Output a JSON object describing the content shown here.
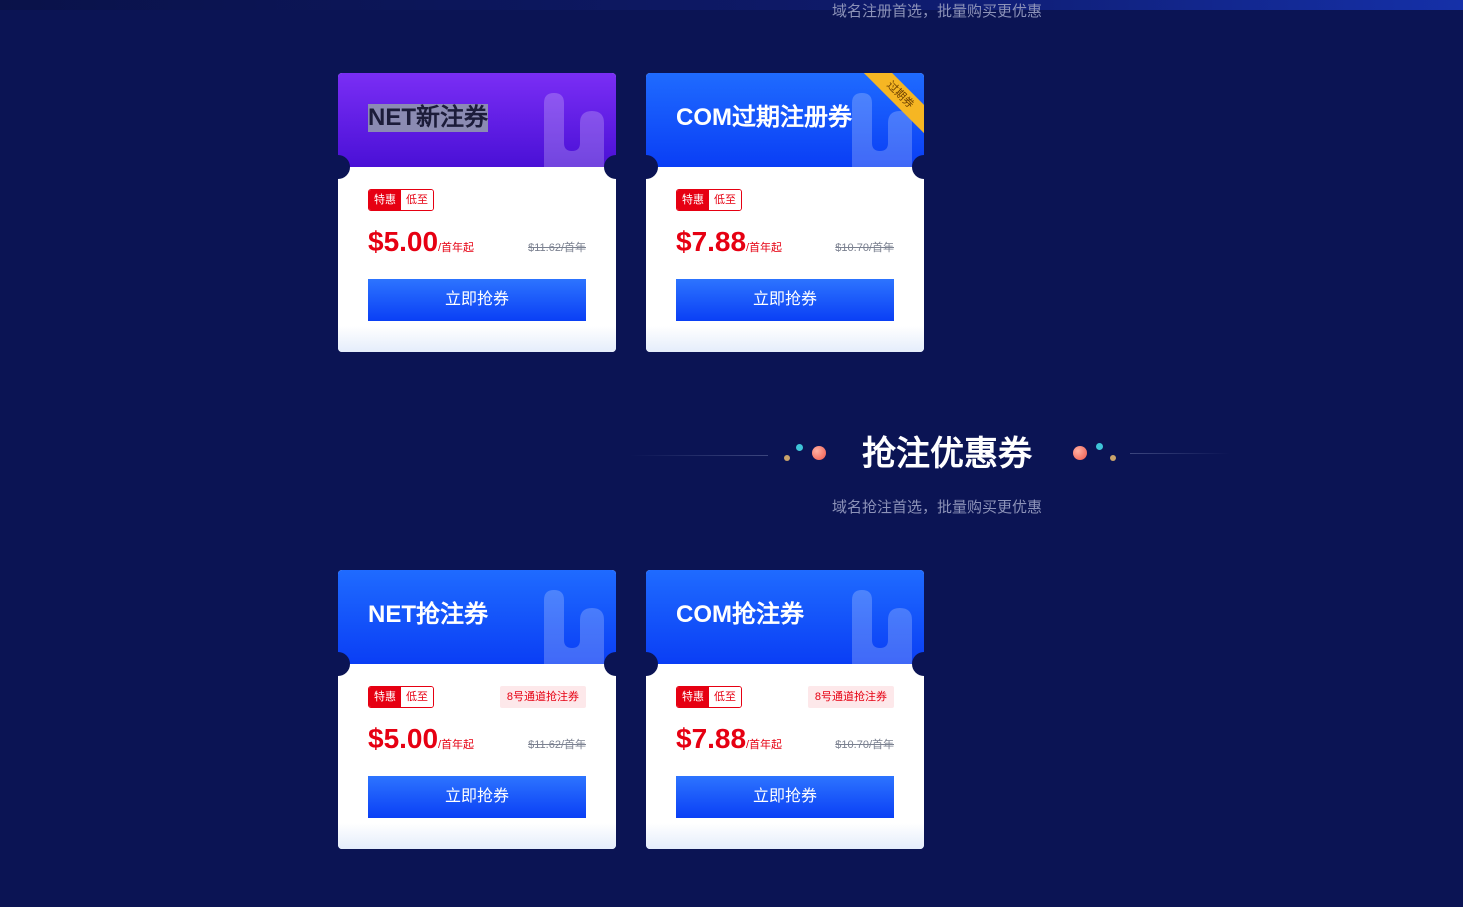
{
  "top_section": {
    "subtitle": "域名注册首选，批量购买更优惠"
  },
  "register_cards": [
    {
      "title": "NET新注券",
      "tag_a": "特惠",
      "tag_b": "低至",
      "price": "$5.00",
      "unit": "/首年起",
      "old_price": "$11.62/首年",
      "button": "立即抢券"
    },
    {
      "title": "COM过期注册券",
      "ribbon": "过期券",
      "tag_a": "特惠",
      "tag_b": "低至",
      "price": "$7.88",
      "unit": "/首年起",
      "old_price": "$10.70/首年",
      "button": "立即抢券"
    }
  ],
  "snap_section": {
    "title": "抢注优惠券",
    "subtitle": "域名抢注首选，批量购买更优惠"
  },
  "snap_cards": [
    {
      "title": "NET抢注券",
      "tag_a": "特惠",
      "tag_b": "低至",
      "channel": "8号通道抢注券",
      "price": "$5.00",
      "unit": "/首年起",
      "old_price": "$11.62/首年",
      "button": "立即抢券"
    },
    {
      "title": "COM抢注券",
      "tag_a": "特惠",
      "tag_b": "低至",
      "channel": "8号通道抢注券",
      "price": "$7.88",
      "unit": "/首年起",
      "old_price": "$10.70/首年",
      "button": "立即抢券"
    }
  ],
  "colors": {
    "background": "#0b1454",
    "accent_blue": "#0a3ef5",
    "accent_purple": "#5a16e0",
    "price_red": "#e60012",
    "ribbon_gold": "#f6b623"
  }
}
